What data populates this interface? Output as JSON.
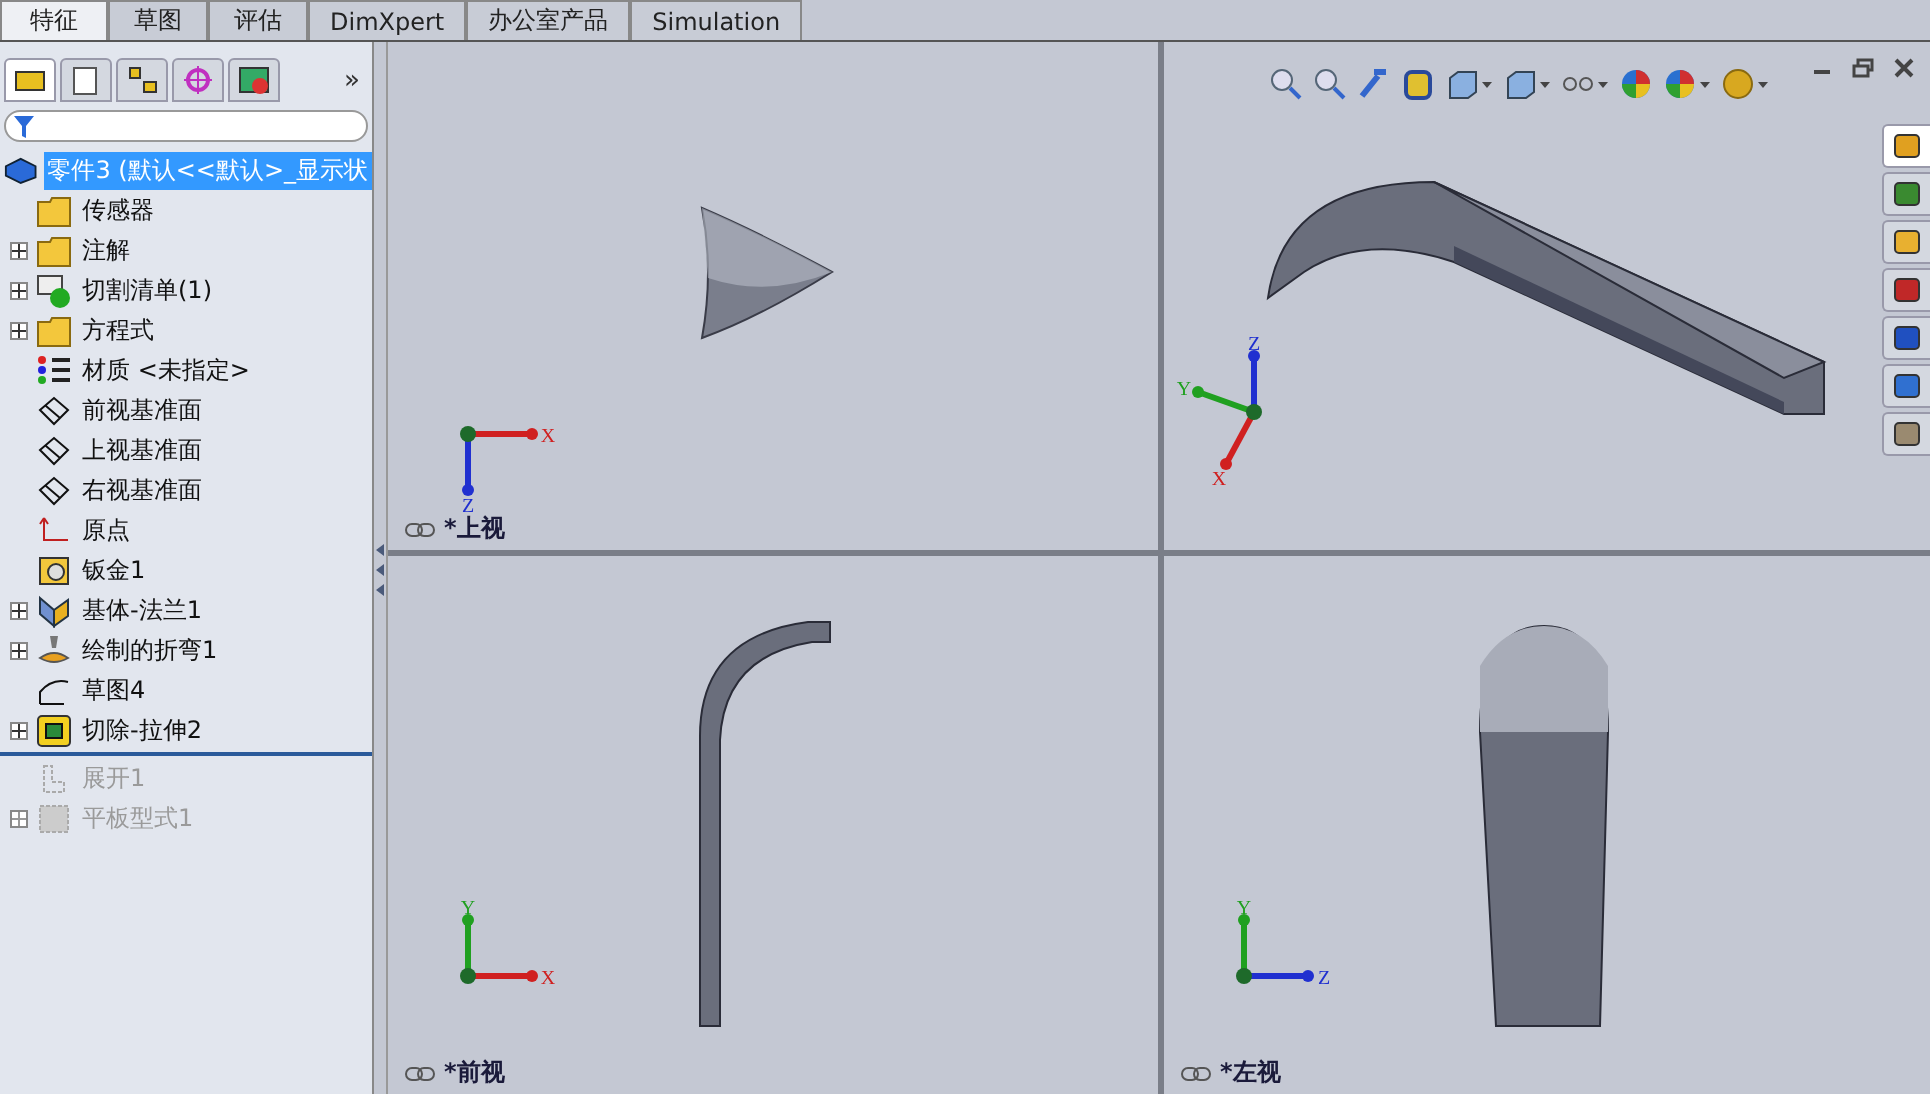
{
  "tabs": [
    {
      "label": "特征",
      "selected": true
    },
    {
      "label": "草图",
      "selected": false
    },
    {
      "label": "评估",
      "selected": false
    },
    {
      "label": "DimXpert",
      "selected": false
    },
    {
      "label": "办公室产品",
      "selected": false
    },
    {
      "label": "Simulation",
      "selected": false
    }
  ],
  "panel_tabs": [
    {
      "selected": true
    },
    {
      "selected": false
    },
    {
      "selected": false
    },
    {
      "selected": false
    },
    {
      "selected": false
    }
  ],
  "panel_more": "»",
  "tree": {
    "root": {
      "label": "零件3 (默认<<默认>_显示状",
      "selected": true
    },
    "items": [
      {
        "label": "传感器",
        "collapsed": false
      },
      {
        "label": "注解",
        "collapsed": true
      },
      {
        "label": "切割清单(1)",
        "collapsed": true
      },
      {
        "label": "方程式",
        "collapsed": true
      },
      {
        "label": "材质 <未指定>",
        "collapsed": false
      },
      {
        "label": "前视基准面",
        "collapsed": false
      },
      {
        "label": "上视基准面",
        "collapsed": false
      },
      {
        "label": "右视基准面",
        "collapsed": false
      },
      {
        "label": "原点",
        "collapsed": false
      },
      {
        "label": "钣金1",
        "collapsed": false
      },
      {
        "label": "基体-法兰1",
        "collapsed": true
      },
      {
        "label": "绘制的折弯1",
        "collapsed": true
      },
      {
        "label": "草图4",
        "collapsed": false
      },
      {
        "label": "切除-拉伸2",
        "collapsed": true
      }
    ],
    "rolled_back_items": [
      {
        "label": "展开1",
        "collapsed": false
      },
      {
        "label": "平板型式1",
        "collapsed": true
      }
    ]
  },
  "viewports": [
    {
      "view_label": "*上视",
      "axes": [
        {
          "label": "X",
          "color": "#d02020"
        },
        {
          "label": "Z",
          "color": "#2030d0"
        }
      ]
    },
    {
      "axes": [
        {
          "label": "Y",
          "color": "#20a020"
        },
        {
          "label": "Z",
          "color": "#2030d0"
        },
        {
          "label": "X",
          "color": "#d02020"
        }
      ]
    },
    {
      "view_label": "*前视",
      "axes": [
        {
          "label": "Y",
          "color": "#20a020"
        },
        {
          "label": "X",
          "color": "#d02020"
        }
      ]
    },
    {
      "view_label": "*左视",
      "axes": [
        {
          "label": "Y",
          "color": "#20a020"
        },
        {
          "label": "Z",
          "color": "#2030d0"
        }
      ]
    }
  ],
  "task_pane": [
    {
      "selected": true
    },
    {
      "selected": false
    },
    {
      "selected": false
    },
    {
      "selected": false
    },
    {
      "selected": false
    },
    {
      "selected": false
    },
    {
      "selected": false
    }
  ]
}
